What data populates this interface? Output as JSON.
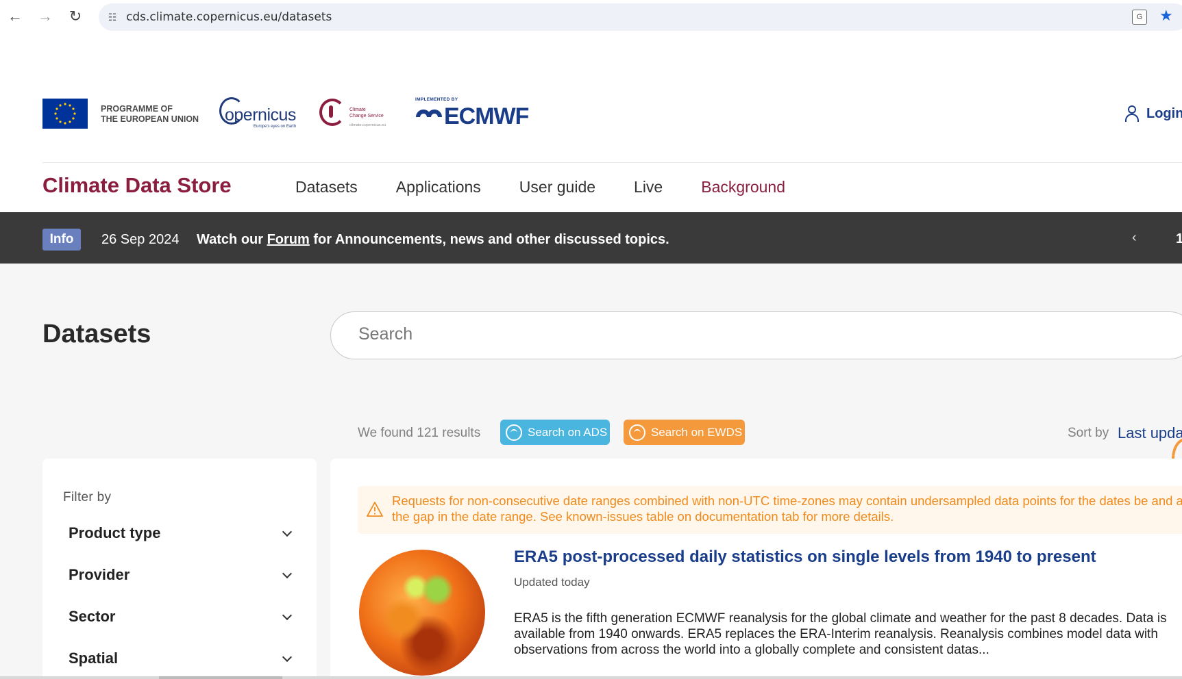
{
  "browser": {
    "url": "cds.climate.copernicus.eu/datasets"
  },
  "header": {
    "eu_line1": "PROGRAMME OF",
    "eu_line2": "THE EUROPEAN UNION",
    "copernicus_word": "opernicus",
    "copernicus_sub": "Europe's eyes on Earth",
    "c3s_line1": "Climate",
    "c3s_line2": "Change Service",
    "c3s_sub": "climate.copernicus.eu",
    "ecmwf_small": "IMPLEMENTED BY",
    "ecmwf_word": "ECMWF",
    "login_label": "Login"
  },
  "nav": {
    "site_title": "Climate Data Store",
    "items": [
      "Datasets",
      "Applications",
      "User guide",
      "Live",
      "Background"
    ]
  },
  "banner": {
    "badge": "Info",
    "date": "26 Sep 2024",
    "msg_before": "Watch our ",
    "msg_link": "Forum",
    "msg_after": " for Announcements, news and other discussed topics.",
    "prev": "‹",
    "page": "1"
  },
  "main": {
    "title": "Datasets",
    "search_placeholder": "Search",
    "results_count": "We found 121 results",
    "btn_ads": "Search on ADS",
    "btn_ewds": "Search on EWDS",
    "sort_label": "Sort by",
    "sort_value": "Last upda"
  },
  "filters": {
    "title": "Filter by",
    "items": [
      "Product type",
      "Provider",
      "Sector",
      "Spatial"
    ]
  },
  "results": {
    "warning": "Requests for non-consecutive date ranges combined with non-UTC time-zones may contain undersampled data points for the dates be and after the gap in the date range. See known-issues table on documentation tab for more details.",
    "items": [
      {
        "title": "ERA5 post-processed daily statistics on single levels from 1940 to present",
        "updated": "Updated today",
        "description": "ERA5 is the fifth generation ECMWF reanalysis for the global climate and weather for the past 8 decades. Data is available from 1940 onwards. ERA5 replaces the ERA-Interim reanalysis. Reanalysis combines model data with observations from across the world into a globally complete and consistent datas..."
      }
    ]
  },
  "colors": {
    "brand_red": "#8b1e3f",
    "brand_blue": "#1a3d8a",
    "banner_bg": "#3a3a3a",
    "ads": "#4ab6e0",
    "ewds": "#f59a3c",
    "warning_text": "#f08a1c"
  }
}
